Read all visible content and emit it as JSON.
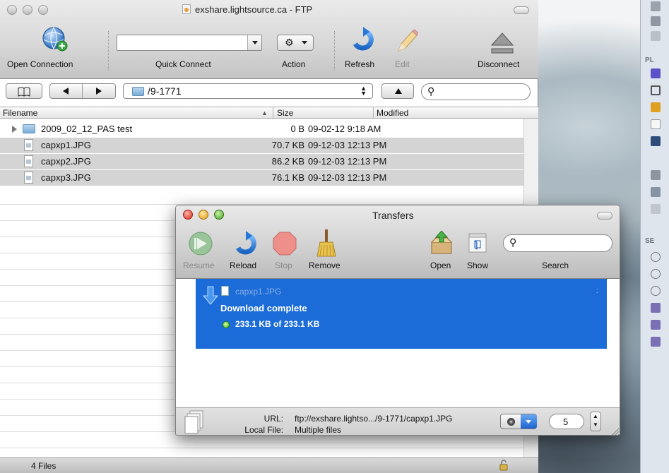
{
  "ftp": {
    "title": "exshare.lightsource.ca - FTP",
    "toolbar": {
      "open_connection": "Open Connection",
      "quick_connect": "Quick Connect",
      "action": "Action",
      "refresh": "Refresh",
      "edit": "Edit",
      "disconnect": "Disconnect"
    },
    "path": "/9-1771",
    "columns": {
      "filename": "Filename",
      "size": "Size",
      "modified": "Modified"
    },
    "files": [
      {
        "name": "2009_02_12_PAS test",
        "size": "0 B",
        "modified": "09-02-12 9:18 AM",
        "kind": "folder"
      },
      {
        "name": "capxp1.JPG",
        "size": "70.7 KB",
        "modified": "09-12-03 12:13 PM",
        "kind": "file"
      },
      {
        "name": "capxp2.JPG",
        "size": "86.2 KB",
        "modified": "09-12-03 12:13 PM",
        "kind": "file"
      },
      {
        "name": "capxp3.JPG",
        "size": "76.1 KB",
        "modified": "09-12-03 12:13 PM",
        "kind": "file"
      }
    ],
    "status": "4 Files"
  },
  "transfers": {
    "title": "Transfers",
    "toolbar": {
      "resume": "Resume",
      "reload": "Reload",
      "stop": "Stop",
      "remove": "Remove",
      "open": "Open",
      "show": "Show",
      "search": "Search"
    },
    "item": {
      "filename": "capxp1.JPG",
      "status": "Download complete",
      "progress": "233.1 KB of 233.1 KB"
    },
    "info": {
      "url_label": "URL:",
      "url_value": "ftp://exshare.lightso.../9-1771/capxp1.JPG",
      "local_label": "Local File:",
      "local_value": "Multiple files"
    },
    "connections": "5"
  },
  "finder_sidebar": {
    "places_head": "PL",
    "search_head": "SE"
  },
  "colors": {
    "selection_blue": "#1b6cd8",
    "row_selected_gray": "#d4d4d4"
  }
}
